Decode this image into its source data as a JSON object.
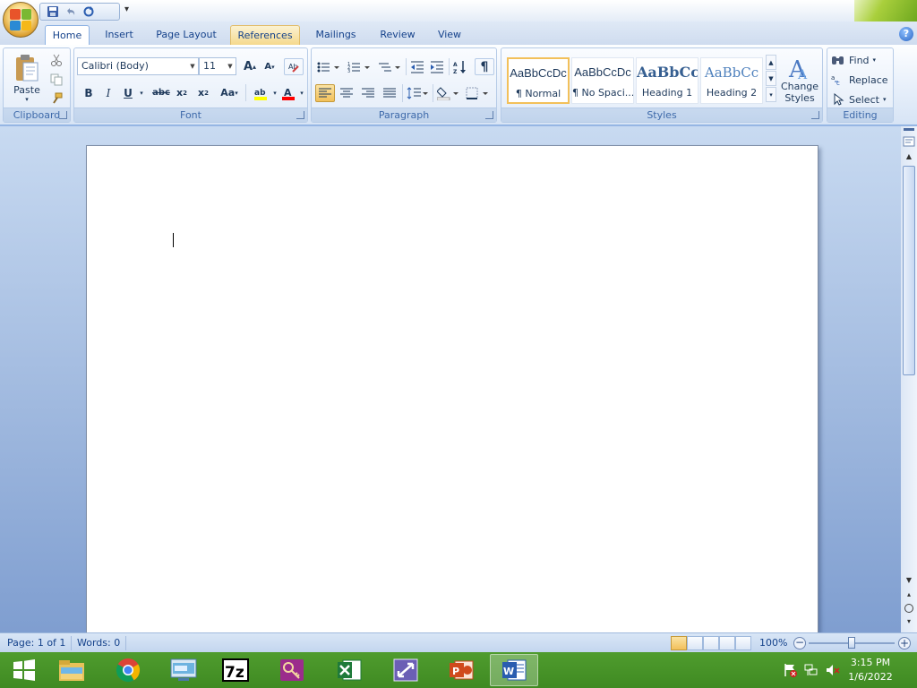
{
  "ribbon": {
    "tabs": [
      {
        "label": "Home"
      },
      {
        "label": "Insert"
      },
      {
        "label": "Page Layout"
      },
      {
        "label": "References"
      },
      {
        "label": "Mailings"
      },
      {
        "label": "Review"
      },
      {
        "label": "View"
      }
    ],
    "active_tab": "Home",
    "clipboard": {
      "paste_label": "Paste",
      "group_label": "Clipboard"
    },
    "font": {
      "font_name": "Calibri (Body)",
      "font_size": "11",
      "group_label": "Font",
      "highlight_color": "#ffff00",
      "font_color": "#ff0000"
    },
    "paragraph": {
      "group_label": "Paragraph"
    },
    "styles": {
      "group_label": "Styles",
      "items": [
        {
          "preview": "AaBbCcDc",
          "name": "¶ Normal"
        },
        {
          "preview": "AaBbCcDc",
          "name": "¶ No Spaci..."
        },
        {
          "preview": "AaBbCc",
          "name": "Heading 1"
        },
        {
          "preview": "AaBbCc",
          "name": "Heading 2"
        }
      ],
      "change_styles_label_1": "Change",
      "change_styles_label_2": "Styles"
    },
    "editing": {
      "find_label": "Find",
      "replace_label": "Replace",
      "select_label": "Select",
      "group_label": "Editing"
    }
  },
  "statusbar": {
    "page": "Page: 1 of 1",
    "words": "Words: 0",
    "zoom": "100%"
  },
  "taskbar": {
    "time": "3:15 PM",
    "date": "1/6/2022",
    "apps": [
      "windows-start",
      "file-explorer",
      "chrome",
      "remote-desktop",
      "7zip",
      "keypass",
      "excel",
      "resize-tool",
      "powerpoint",
      "word"
    ]
  },
  "colors": {
    "accent": "#15428b",
    "taskbar": "#4a9a2c",
    "selected_style": "#f2c05a"
  }
}
